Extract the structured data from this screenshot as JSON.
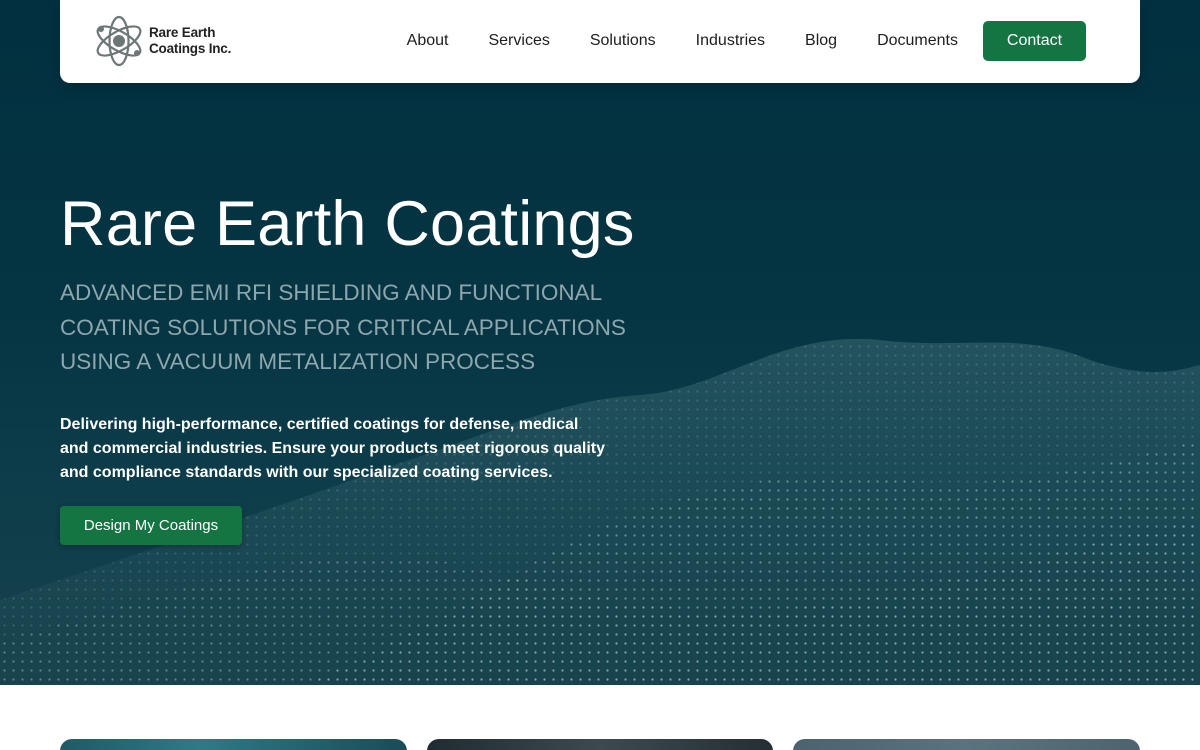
{
  "brand": {
    "name_line1": "Rare Earth",
    "name_line2": "Coatings Inc.",
    "logo_icon": "atom-icon"
  },
  "nav": {
    "items": [
      {
        "label": "About"
      },
      {
        "label": "Services"
      },
      {
        "label": "Solutions"
      },
      {
        "label": "Industries"
      },
      {
        "label": "Blog"
      },
      {
        "label": "Documents"
      }
    ],
    "contact_label": "Contact"
  },
  "hero": {
    "title": "Rare Earth Coatings",
    "subtitle_lines": [
      "ADVANCED EMI RFI SHIELDING AND FUNCTIONAL",
      "COATING SOLUTIONS FOR CRITICAL APPLICATIONS",
      "USING A VACUUM METALIZATION PROCESS"
    ],
    "description_lines": [
      "Delivering high-performance, certified coatings for defense, medical",
      "and commercial industries. Ensure your products meet rigorous quality",
      "and compliance standards with our specialized coating services."
    ],
    "cta_label": "Design My Coatings"
  },
  "colors": {
    "accent": "#147543",
    "hero_background": "#023040",
    "subtitle_text": "#8ea6ad"
  }
}
